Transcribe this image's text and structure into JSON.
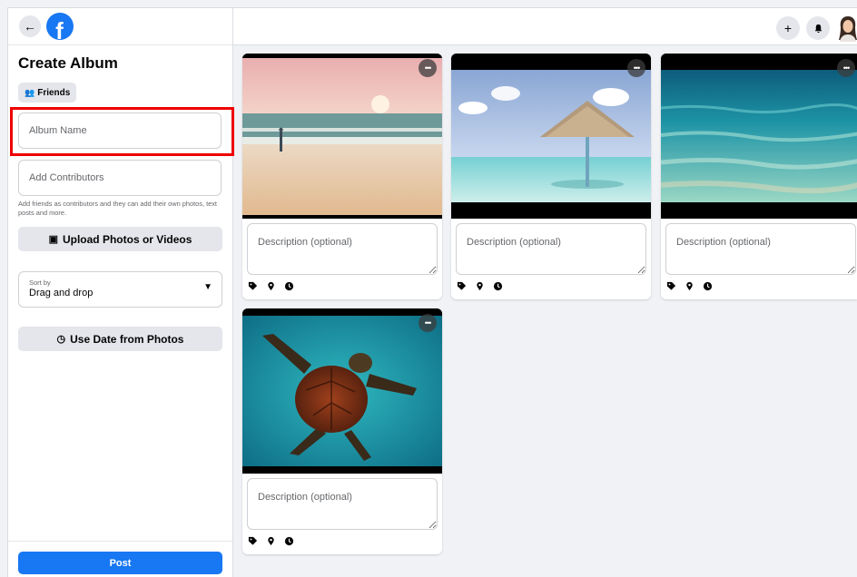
{
  "header": {
    "back_icon": "arrow-left-icon",
    "logo_letter": "f",
    "plus_glyph": "+",
    "bell_icon": "bell-icon"
  },
  "sidebar": {
    "title": "Create Album",
    "audience_label": "Friends",
    "album_name_placeholder": "Album Name",
    "contributors_placeholder": "Add Contributors",
    "contributors_helper": "Add friends as contributors and they can add their own photos, text posts and more.",
    "upload_label": "Upload Photos or Videos",
    "sort": {
      "label": "Sort by",
      "value": "Drag and drop"
    },
    "use_date_label": "Use Date from Photos",
    "post_label": "Post"
  },
  "photos": [
    {
      "scene": "beach-sunset-person",
      "description_placeholder": "Description (optional)"
    },
    {
      "scene": "beach-umbrella",
      "description_placeholder": "Description (optional)"
    },
    {
      "scene": "clear-sea-water",
      "description_placeholder": "Description (optional)"
    },
    {
      "scene": "sea-turtle",
      "description_placeholder": "Description (optional)"
    }
  ],
  "photo_actions": [
    "tag-icon",
    "location-pin-icon",
    "clock-icon"
  ],
  "colors": {
    "brand_blue": "#1877f2",
    "highlight_red": "#ee0000"
  }
}
